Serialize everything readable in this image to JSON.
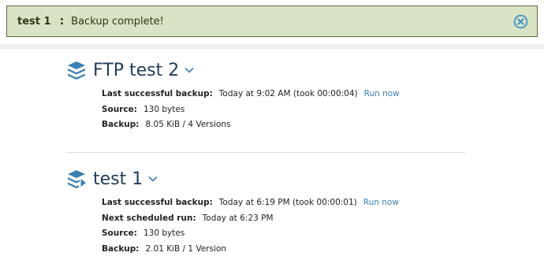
{
  "notification": {
    "name": "test 1",
    "separator": ":",
    "message": "Backup complete!"
  },
  "backups": [
    {
      "title": "FTP test 2",
      "last_label": "Last successful backup:",
      "last_value": "Today at 9:02 AM (took 00:00:04)",
      "run_now": "Run now",
      "source_label": "Source:",
      "source_value": "130 bytes",
      "backup_label": "Backup:",
      "backup_value": "8.05 KiB / 4 Versions"
    },
    {
      "title": "test 1",
      "last_label": "Last successful backup:",
      "last_value": "Today at 6:19 PM (took 00:00:01)",
      "run_now": "Run now",
      "next_label": "Next scheduled run:",
      "next_value": "Today at 6:23 PM",
      "source_label": "Source:",
      "source_value": "130 bytes",
      "backup_label": "Backup:",
      "backup_value": "2.01 KiB / 1 Version"
    }
  ],
  "colors": {
    "notification_bg": "#d8e4c3",
    "title": "#1f3d5c",
    "link": "#3a7fb3",
    "icon": "#3a7fb3"
  }
}
